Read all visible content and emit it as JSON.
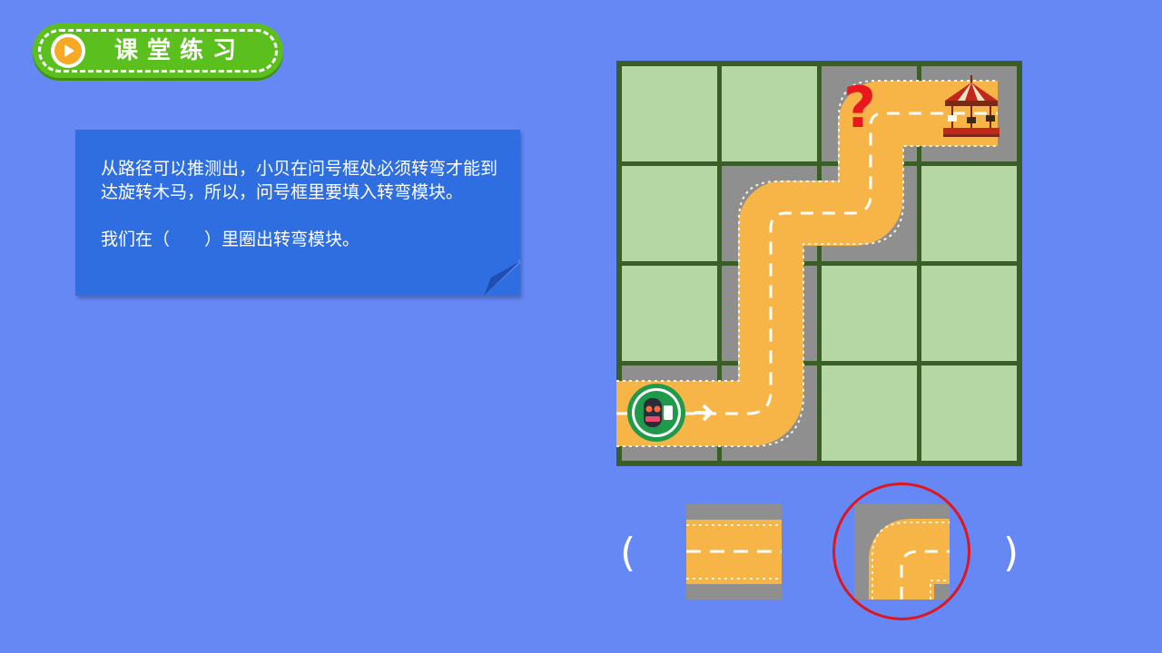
{
  "header": {
    "title": "课堂练习",
    "icon": "play-icon",
    "colors": {
      "badge": "#5bbf1d",
      "play": "#f7a825"
    }
  },
  "card": {
    "paragraph1": "从路径可以推测出，小贝在问号框处必须转弯才能到达旋转木马，所以，问号框里要填入转弯模块。",
    "paragraph2": "我们在（　　）里圈出转弯模块。",
    "color": "#2f6ee0"
  },
  "grid": {
    "rows": 4,
    "cols": 4,
    "question_mark": "?",
    "start_icon": "robot-car-icon",
    "goal_icon": "carousel-icon",
    "colors": {
      "grass": "#b5d7a3",
      "road": "#f7b547",
      "asphalt": "#8f8f8f",
      "border": "#3b5e28",
      "question": "#e8181e"
    }
  },
  "options": {
    "open_paren": "(",
    "close_paren": ")",
    "choices": [
      {
        "name": "straight-road-tile",
        "selected": false
      },
      {
        "name": "curve-road-tile",
        "selected": true
      }
    ],
    "circle_color": "#e0161c"
  }
}
